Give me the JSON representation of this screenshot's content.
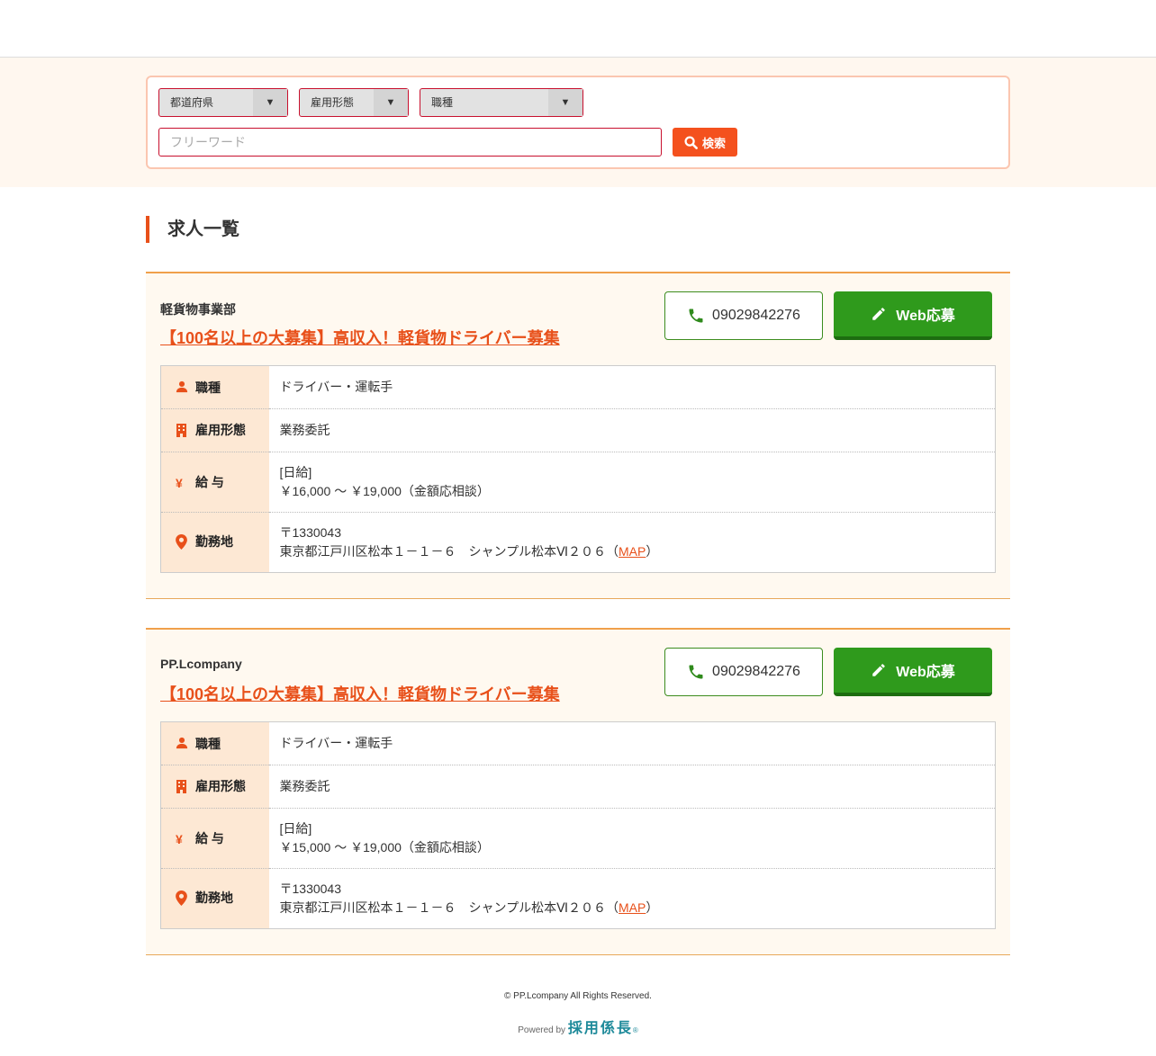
{
  "search": {
    "prefecture_label": "都道府県",
    "employment_label": "雇用形態",
    "jobtype_label": "職種",
    "arrow": "▼",
    "freeword_placeholder": "フリーワード",
    "search_button": "検索"
  },
  "list_title": "求人一覧",
  "jobs": [
    {
      "company": "軽貨物事業部",
      "title": "【100名以上の大募集】高収入！軽貨物ドライバー募集",
      "phone": "09029842276",
      "web_apply": "Web応募",
      "labels": {
        "job_type": "職種",
        "employment": "雇用形態",
        "salary": "給 与",
        "location": "勤務地"
      },
      "job_type": "ドライバー・運転手",
      "employment": "業務委託",
      "salary_type": "[日給]",
      "salary_range": "￥16,000 ～ ￥19,000（金額応相談）",
      "postal": "〒1330043",
      "address": "東京都江戸川区松本１－１－６　シャンプル松本Ⅵ２０６（",
      "map": "MAP",
      "address_close": "）"
    },
    {
      "company": "PP.Lcompany",
      "title": "【100名以上の大募集】高収入！軽貨物ドライバー募集",
      "phone": "09029842276",
      "web_apply": "Web応募",
      "labels": {
        "job_type": "職種",
        "employment": "雇用形態",
        "salary": "給 与",
        "location": "勤務地"
      },
      "job_type": "ドライバー・運転手",
      "employment": "業務委託",
      "salary_type": "[日給]",
      "salary_range": "￥15,000 ～ ￥19,000（金額応相談）",
      "postal": "〒1330043",
      "address": "東京都江戸川区松本１－１－６　シャンプル松本Ⅵ２０６（",
      "map": "MAP",
      "address_close": "）"
    }
  ],
  "footer": {
    "copyright": "© PP.Lcompany All Rights Reserved.",
    "powered_by": "Powered by",
    "brand": "採用係長",
    "brand_mark": "®"
  },
  "colors": {
    "accent": "#e8501a",
    "green": "#2f9a1c",
    "label_bg": "#fde8d4",
    "band_bg": "#fff7ef"
  }
}
